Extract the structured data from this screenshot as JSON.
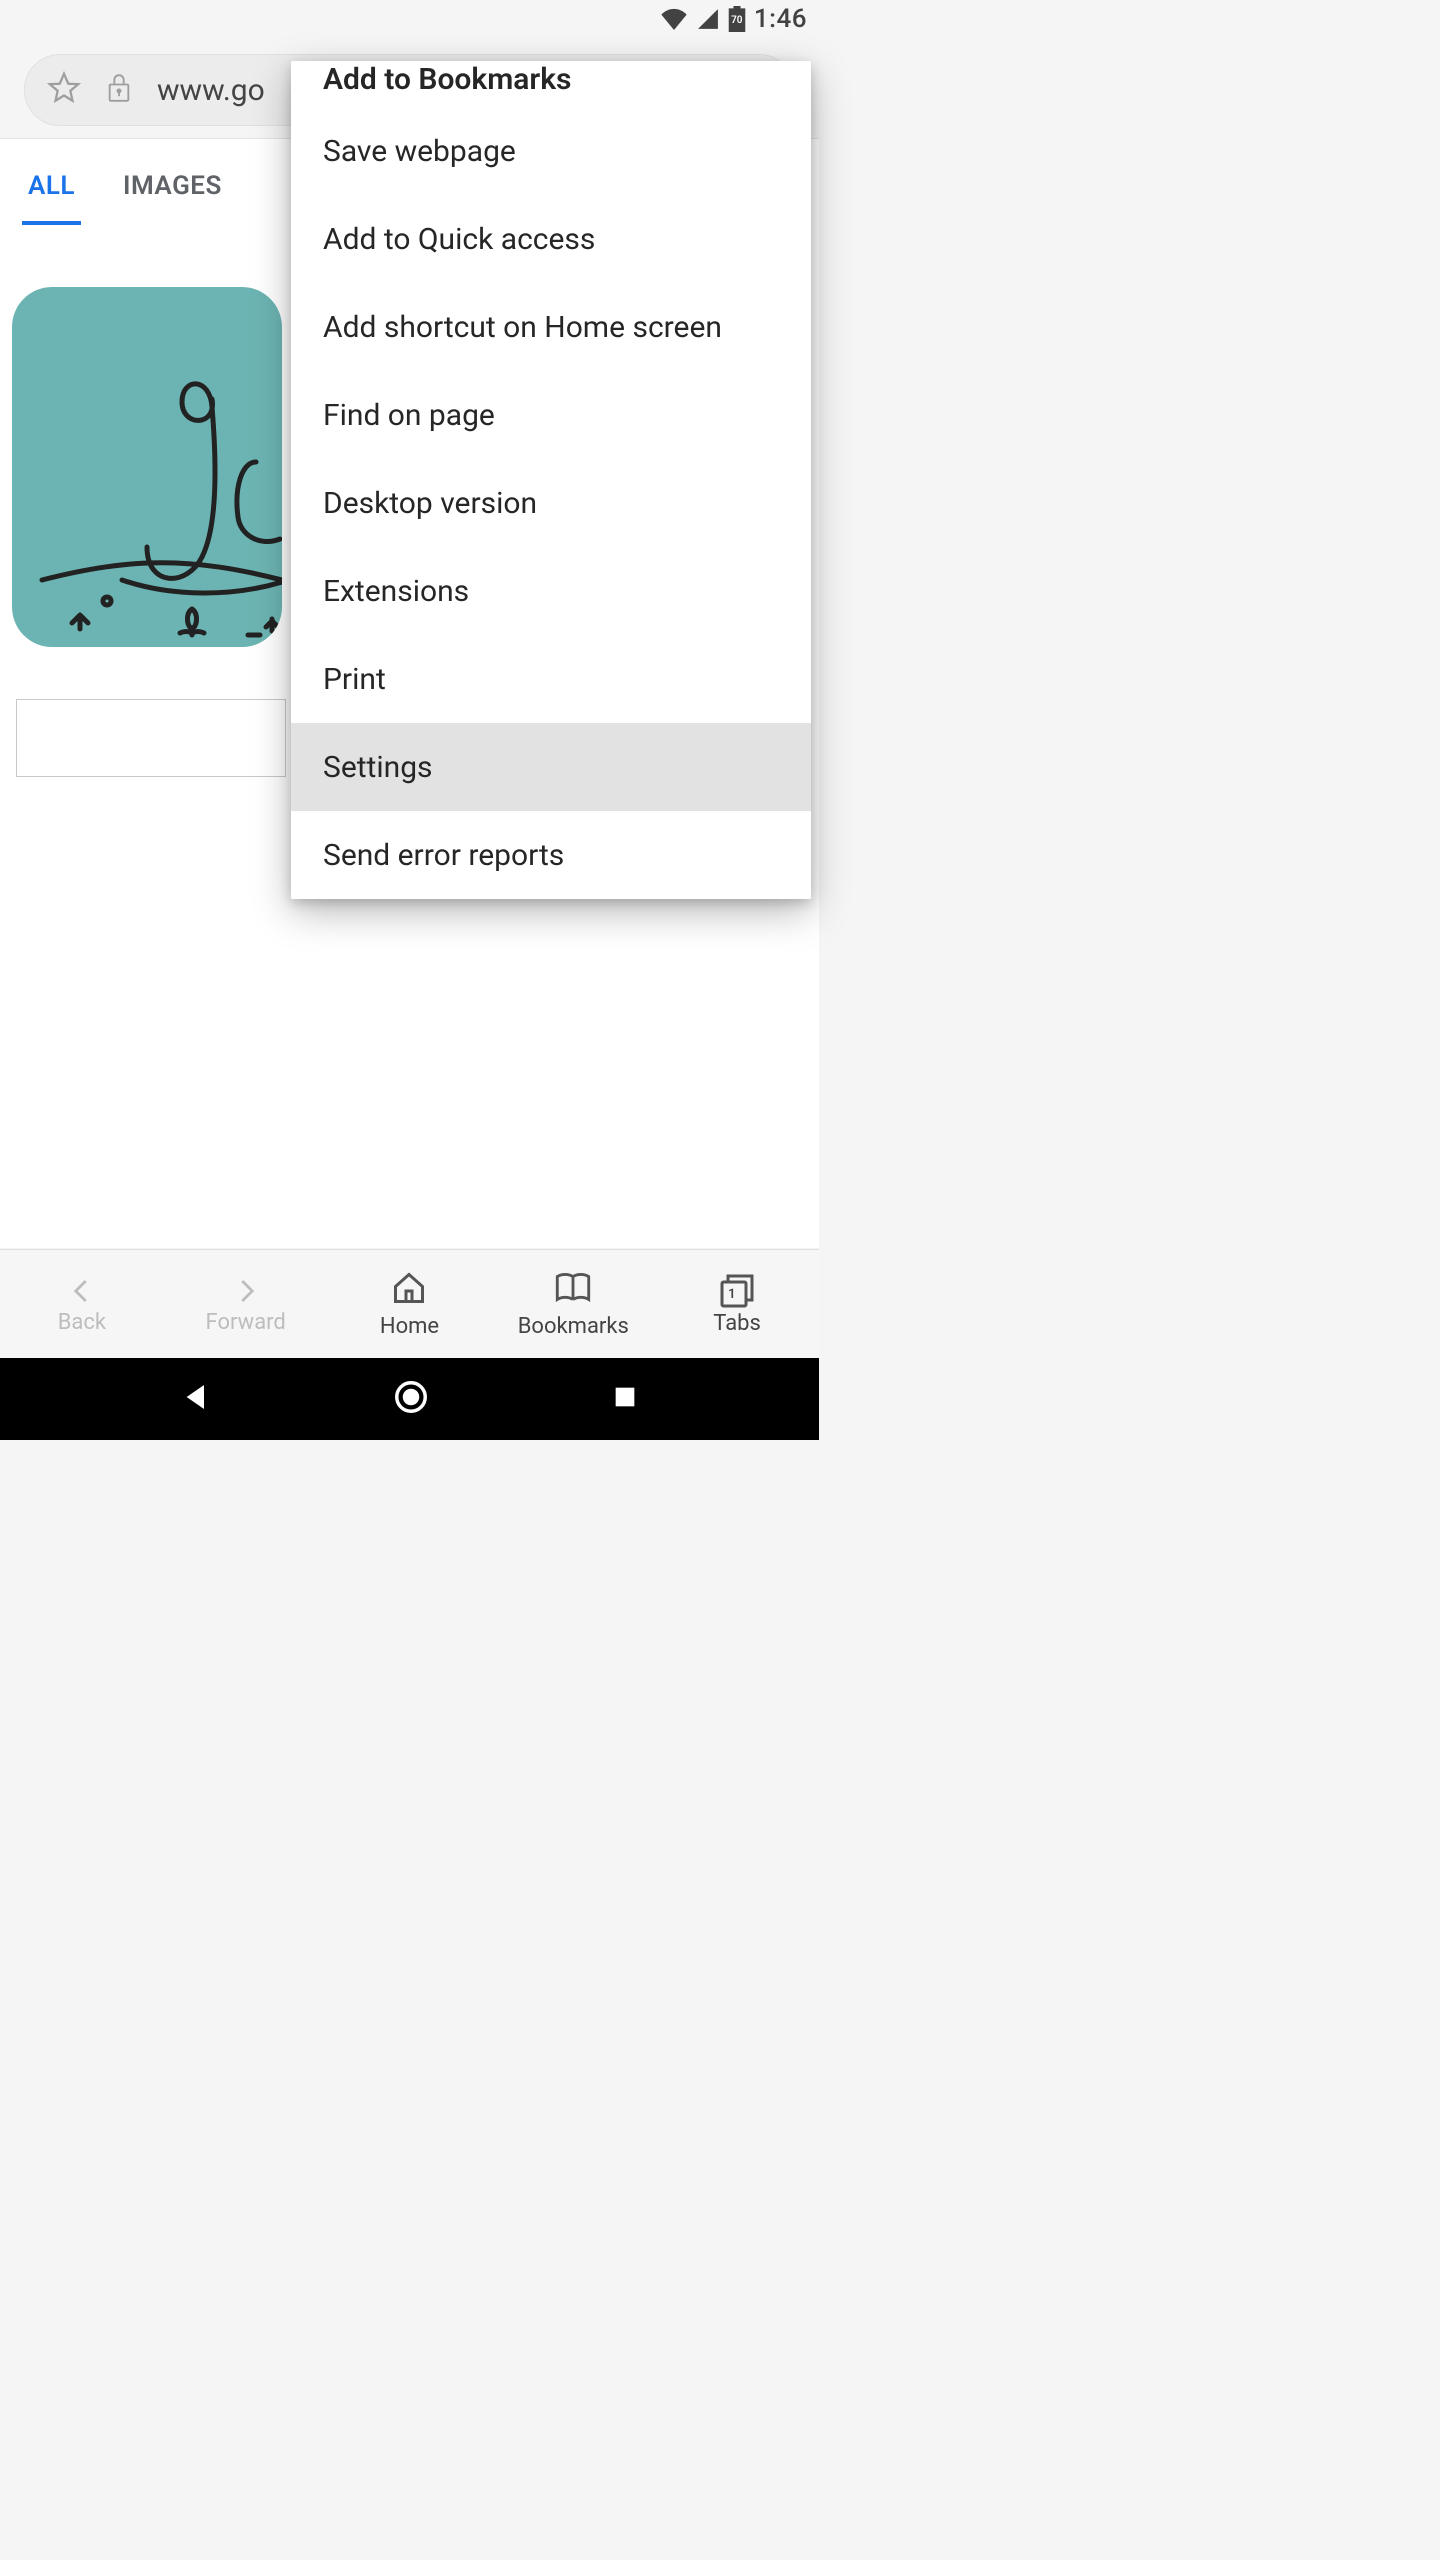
{
  "status_bar": {
    "battery_pct": "70",
    "time": "1:46"
  },
  "url_bar": {
    "url": "www.go"
  },
  "page": {
    "tab_all": "ALL",
    "tab_images": "IMAGES"
  },
  "menu": {
    "add_bookmarks": "Add to Bookmarks",
    "save_webpage": "Save webpage",
    "add_quick_access": "Add to Quick access",
    "add_home_shortcut": "Add shortcut on Home screen",
    "find_on_page": "Find on page",
    "desktop_version": "Desktop version",
    "extensions": "Extensions",
    "print": "Print",
    "settings": "Settings",
    "send_error": "Send error reports"
  },
  "browser_nav": {
    "back": "Back",
    "forward": "Forward",
    "home": "Home",
    "bookmarks": "Bookmarks",
    "tabs": "Tabs",
    "tab_count": "1"
  }
}
